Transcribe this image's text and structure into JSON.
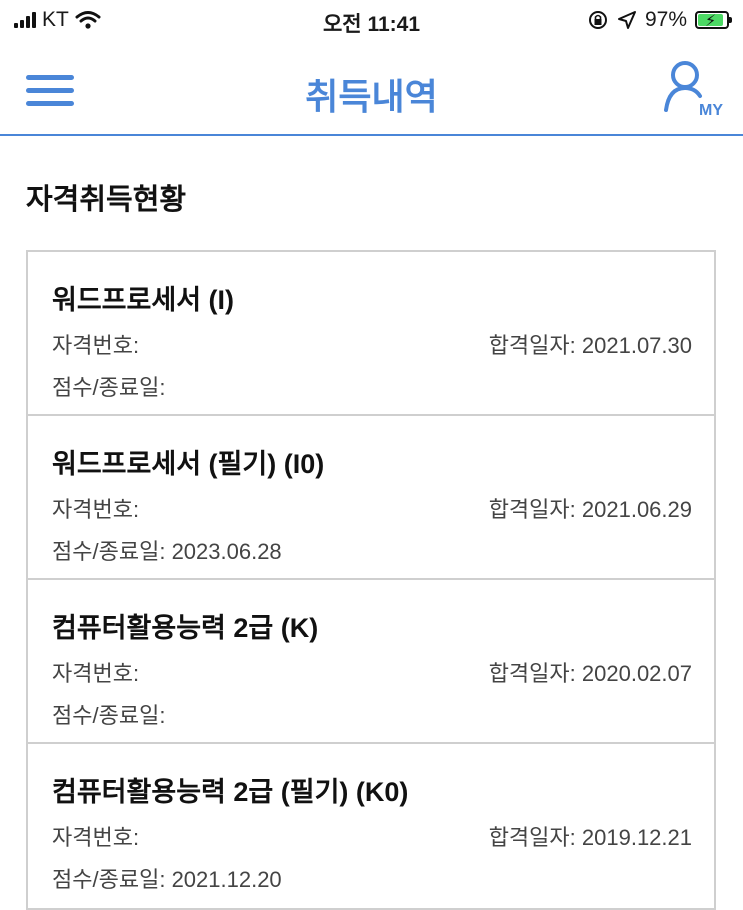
{
  "status_bar": {
    "carrier": "KT",
    "time": "오전 11:41",
    "battery_percent": "97%",
    "battery_level": 0.97
  },
  "navbar": {
    "title": "취득내역",
    "my_label": "MY",
    "accent_color": "#4a86d8"
  },
  "section_title": "자격취득현황",
  "certificates": [
    {
      "title": "워드프로세서 (I)",
      "number_label": "자격번호:",
      "pass_label": "합격일자:",
      "pass_date": "2021.07.30",
      "score_label": "점수/종료일:",
      "score_value": ""
    },
    {
      "title": "워드프로세서 (필기) (I0)",
      "number_label": "자격번호:",
      "pass_label": "합격일자:",
      "pass_date": "2021.06.29",
      "score_label": "점수/종료일:",
      "score_value": "2023.06.28"
    },
    {
      "title": "컴퓨터활용능력 2급 (K)",
      "number_label": "자격번호:",
      "pass_label": "합격일자:",
      "pass_date": "2020.02.07",
      "score_label": "점수/종료일:",
      "score_value": ""
    },
    {
      "title": "컴퓨터활용능력 2급 (필기) (K0)",
      "number_label": "자격번호:",
      "pass_label": "합격일자:",
      "pass_date": "2019.12.21",
      "score_label": "점수/종료일:",
      "score_value": "2021.12.20"
    }
  ]
}
